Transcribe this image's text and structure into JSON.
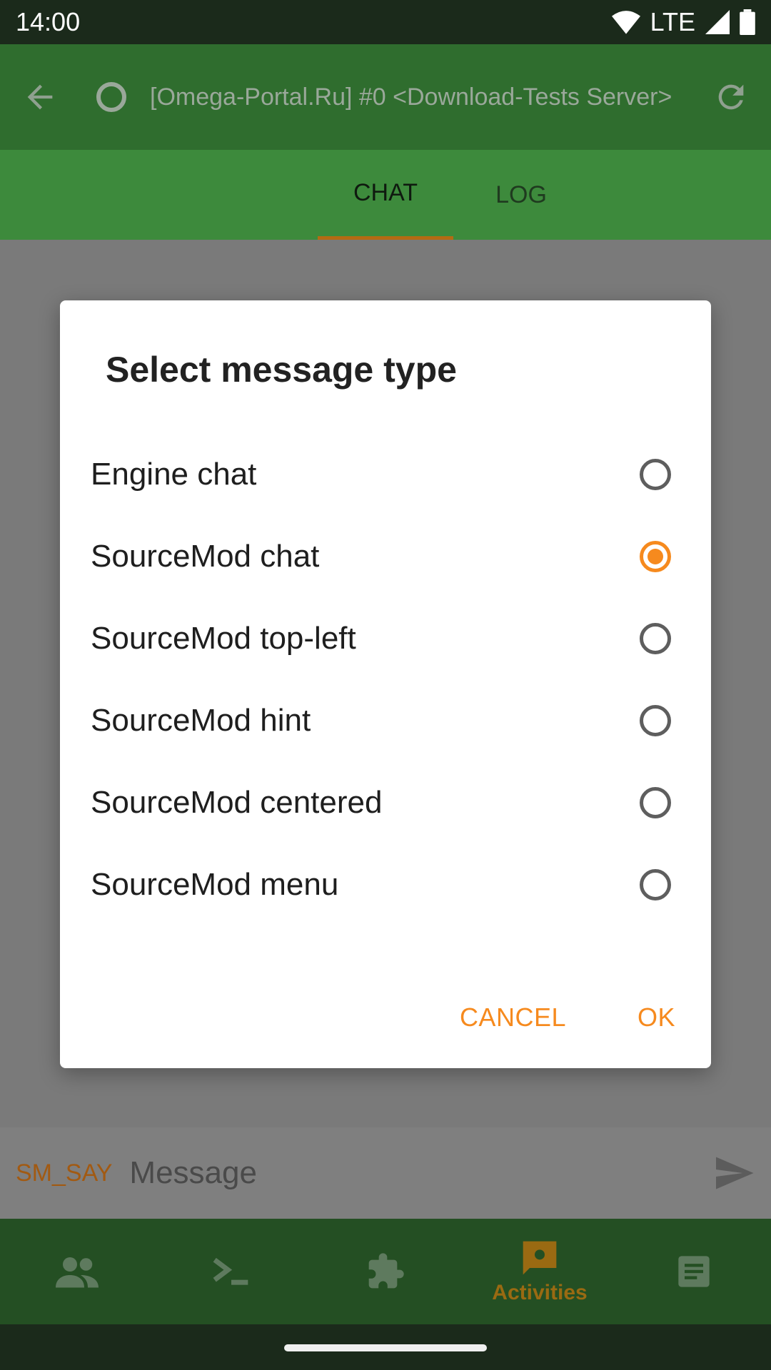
{
  "status_bar": {
    "time": "14:00",
    "network": "LTE"
  },
  "app_bar": {
    "title": "[Omega-Portal.Ru] #0 <Download-Tests Server>"
  },
  "tabs": [
    {
      "label": "CHAT",
      "selected": true
    },
    {
      "label": "LOG",
      "selected": false
    }
  ],
  "input_bar": {
    "prefix": "SM_SAY",
    "placeholder": "Message"
  },
  "bottom_nav": {
    "items": [
      {
        "icon": "people-icon"
      },
      {
        "icon": "terminal-icon"
      },
      {
        "icon": "puzzle-icon"
      },
      {
        "icon": "activities-icon",
        "label": "Activities",
        "selected": true
      },
      {
        "icon": "notes-icon"
      }
    ]
  },
  "dialog": {
    "title": "Select message type",
    "options": [
      {
        "label": "Engine chat",
        "selected": false
      },
      {
        "label": "SourceMod chat",
        "selected": true
      },
      {
        "label": "SourceMod top-left",
        "selected": false
      },
      {
        "label": "SourceMod hint",
        "selected": false
      },
      {
        "label": "SourceMod centered",
        "selected": false
      },
      {
        "label": "SourceMod menu",
        "selected": false
      }
    ],
    "cancel_label": "CANCEL",
    "ok_label": "OK"
  },
  "colors": {
    "accent": "#f68a1e",
    "app_bar": "#2f6d2e",
    "tabs": "#3d8a3c",
    "bottom_nav": "#244f23"
  }
}
